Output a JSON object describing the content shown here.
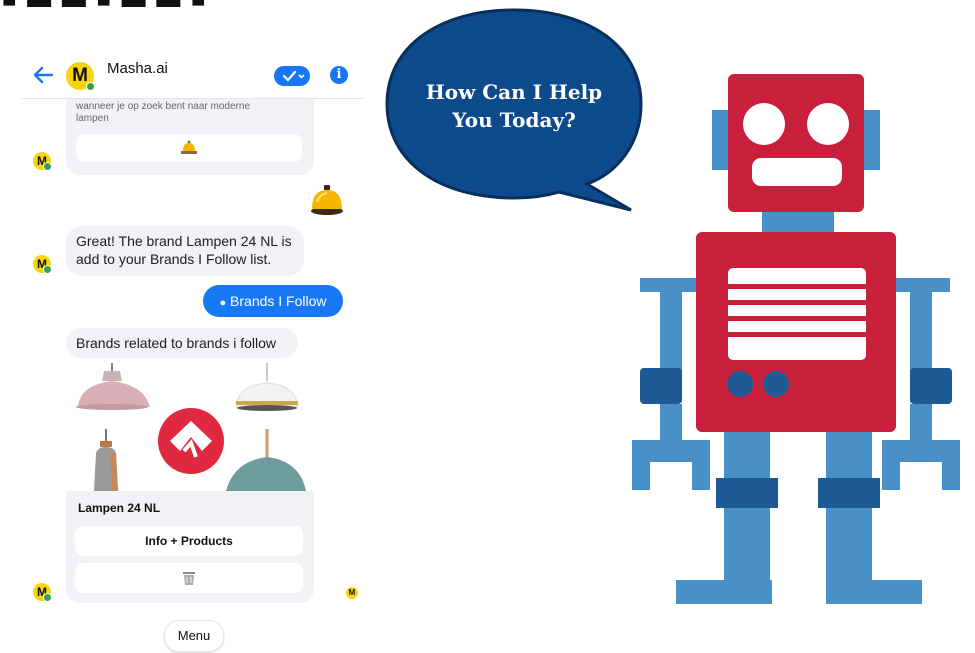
{
  "header": {
    "bot_name": "Masha.ai",
    "avatar_letter": "M"
  },
  "messages": {
    "card_text": "wanneer je op zoek bent naar moderne lampen",
    "confirm_text": "Great! The brand Lampen 24 NL is add to your Brands I Follow list.",
    "quick_reply": "Brands I Follow",
    "related_text": "Brands related to brands i follow"
  },
  "gallery": {
    "title": "Lampen 24 NL",
    "button_info": "Info + Products"
  },
  "menu_label": "Menu",
  "speech": {
    "line1": "How Can I Help",
    "line2": "You Today?"
  },
  "colors": {
    "messenger_blue": "#1877f2",
    "avatar_yellow": "#f7d40b",
    "speech_bubble": "#0d4a8c",
    "robot_red": "#c8203a",
    "robot_blue": "#4a90c8",
    "robot_dark_blue": "#1e5a96"
  }
}
